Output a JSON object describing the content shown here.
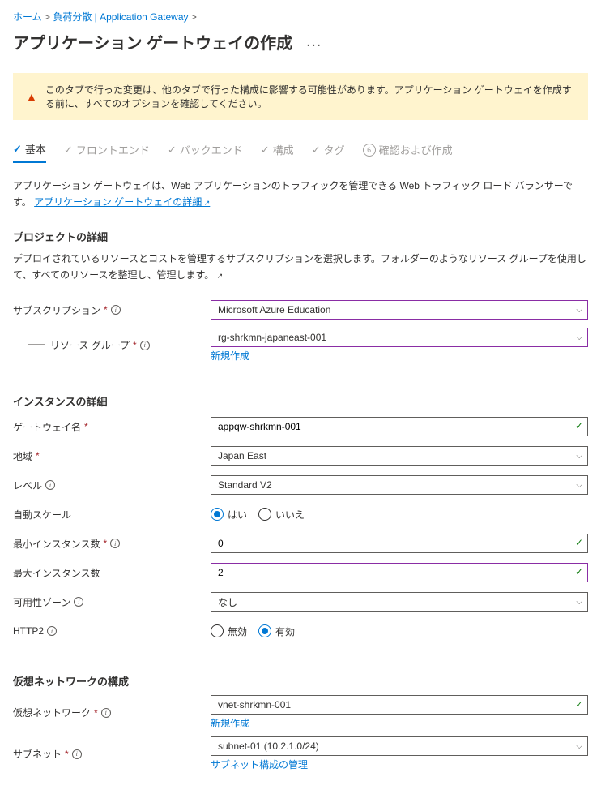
{
  "breadcrumb": {
    "home": "ホーム",
    "link1": "負荷分散 | Application Gateway",
    "sep": " > "
  },
  "page": {
    "title": "アプリケーション ゲートウェイの作成",
    "ellipsis": "…"
  },
  "alert": {
    "text": "このタブで行った変更は、他のタブで行った構成に影響する可能性があります。アプリケーション ゲートウェイを作成する前に、すべてのオプションを確認してください。"
  },
  "tabs": {
    "basic": "基本",
    "frontend": "フロントエンド",
    "backend": "バックエンド",
    "config": "構成",
    "tag": "タグ",
    "review_num": "6",
    "review": "確認および作成"
  },
  "intro": {
    "text": "アプリケーション ゲートウェイは、Web アプリケーションのトラフィックを管理できる Web トラフィック ロード バランサーです。 ",
    "link": "アプリケーション ゲートウェイの詳細"
  },
  "project": {
    "title": "プロジェクトの詳細",
    "desc": "デプロイされているリソースとコストを管理するサブスクリプションを選択します。フォルダーのようなリソース グループを使用して、すべてのリソースを整理し、管理します。"
  },
  "labels": {
    "subscription": "サブスクリプション",
    "resource_group": "リソース グループ",
    "create_new": "新規作成",
    "gateway_name": "ゲートウェイ名",
    "region": "地域",
    "tier": "レベル",
    "autoscale": "自動スケール",
    "min_instances": "最小インスタンス数",
    "max_instances": "最大インスタンス数",
    "availability_zone": "可用性ゾーン",
    "http2": "HTTP2",
    "vnet": "仮想ネットワーク",
    "subnet": "サブネット",
    "manage_subnet": "サブネット構成の管理"
  },
  "values": {
    "subscription": "Microsoft Azure Education",
    "resource_group": "rg-shrkmn-japaneast-001",
    "gateway_name": "appqw-shrkmn-001",
    "region": "Japan East",
    "tier": "Standard V2",
    "min_instances": "0",
    "max_instances": "2",
    "availability_zone": "なし",
    "vnet": "vnet-shrkmn-001",
    "subnet": "subnet-01 (10.2.1.0/24)"
  },
  "radios": {
    "yes": "はい",
    "no": "いいえ",
    "disabled": "無効",
    "enabled": "有効"
  },
  "instance": {
    "title": "インスタンスの詳細"
  },
  "vnet_section": {
    "title": "仮想ネットワークの構成"
  }
}
